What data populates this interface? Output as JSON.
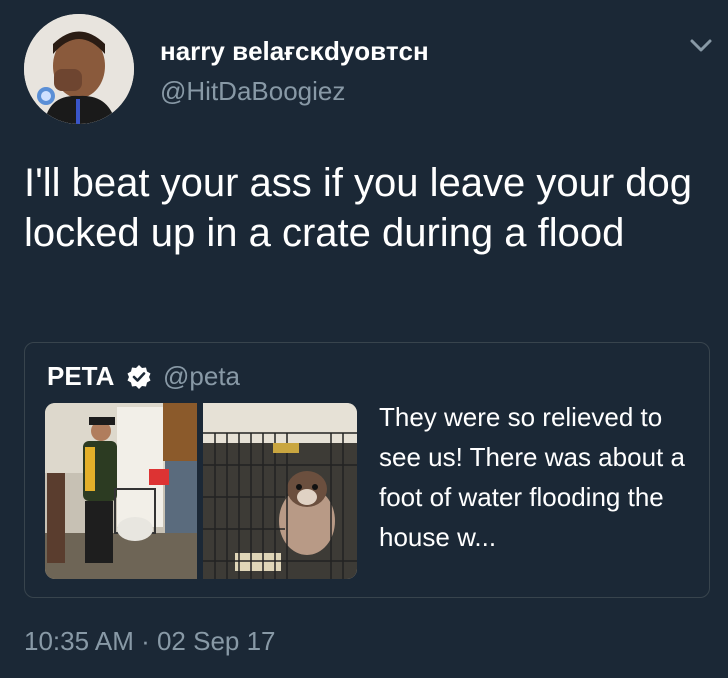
{
  "author": {
    "display_name": "нarry вelaғcĸdyoвтcн",
    "handle": "@HitDaBoogiez",
    "avatar_icon": "profile-photo"
  },
  "menu_icon": "chevron-down-icon",
  "tweet": {
    "text": "I'll beat your ass if you leave your dog locked up in a crate during a flood"
  },
  "quoted_tweet": {
    "display_name": "PETA",
    "verified_icon": "verified-badge-icon",
    "handle": "@peta",
    "text": "They were so relieved to see us! There was about a foot of water flooding the house w..."
  },
  "timestamp": "10:35 AM · 02 Sep 17",
  "colors": {
    "background": "#1b2836",
    "primary_text": "#ffffff",
    "secondary_text": "#8899a6",
    "border": "#38444d"
  }
}
